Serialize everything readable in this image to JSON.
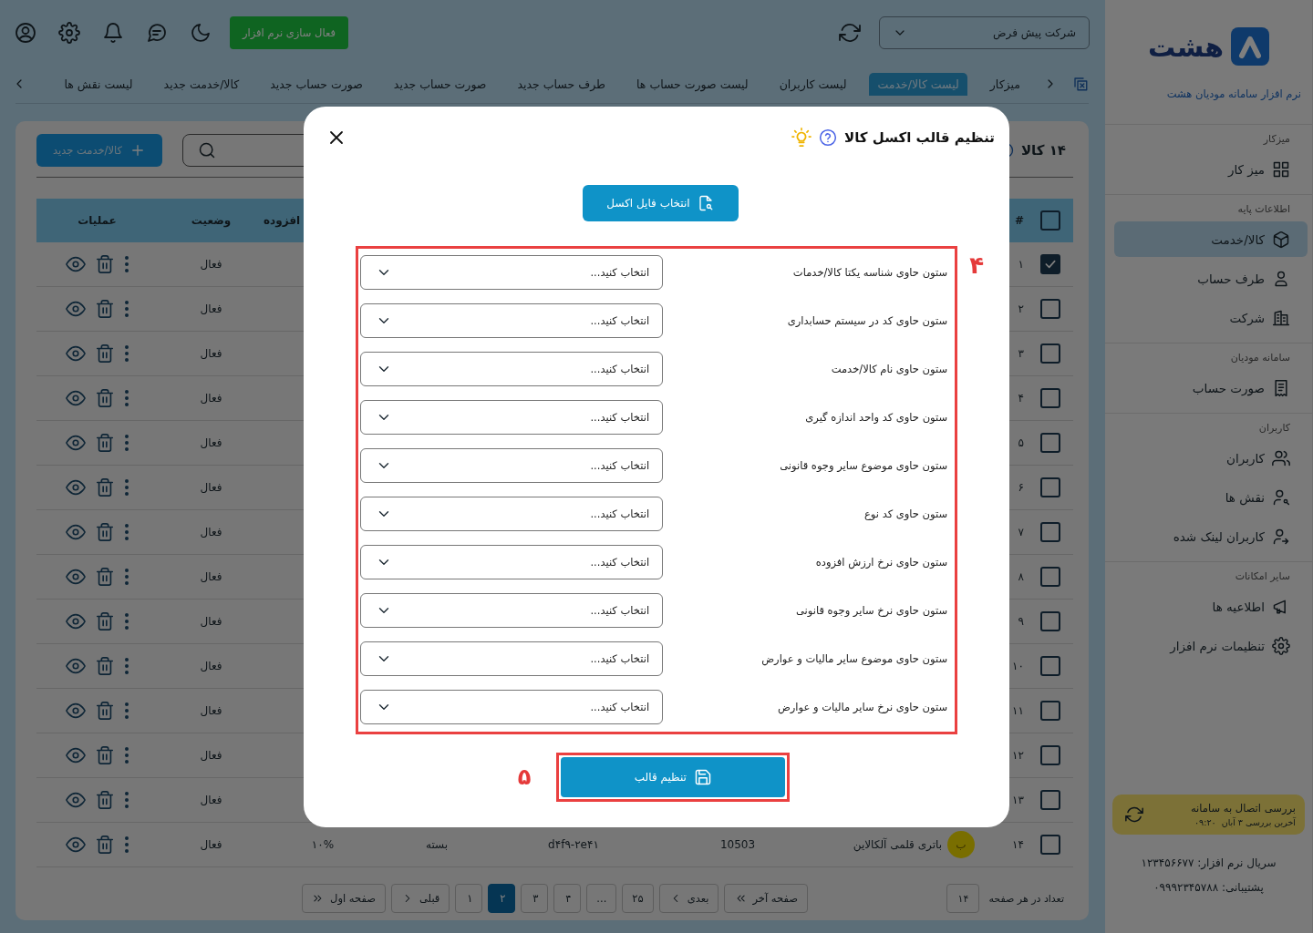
{
  "header": {
    "company_select": {
      "value": "شرکت پیش فرض"
    },
    "activate_button": "فعال سازی نرم افزار"
  },
  "tabs": [
    {
      "label": "میزکار",
      "selected": false
    },
    {
      "label": "لیست کالا/خدمت",
      "selected": true
    },
    {
      "label": "لیست کاربران",
      "selected": false
    },
    {
      "label": "لیست صورت حساب ها",
      "selected": false
    },
    {
      "label": "طرف حساب جدید",
      "selected": false
    },
    {
      "label": "صورت حساب جدید",
      "selected": false
    },
    {
      "label": "صورت حساب جدید",
      "selected": false
    },
    {
      "label": "کالا/خدمت جدید",
      "selected": false
    },
    {
      "label": "لیست نقش ها",
      "selected": false
    }
  ],
  "sidebar": {
    "logo": "هشت",
    "subtitle": "نرم افزار سامانه مودیان هشت",
    "sections": [
      {
        "title": "میزکار",
        "items": [
          {
            "label": "میز کار",
            "kind": "grid",
            "selected": false
          }
        ]
      },
      {
        "title": "اطلاعات پایه",
        "items": [
          {
            "label": "کالا/خدمت",
            "kind": "box",
            "selected": true
          },
          {
            "label": "طرف حساب",
            "kind": "person",
            "selected": false
          },
          {
            "label": "شرکت",
            "kind": "building",
            "selected": false
          }
        ]
      },
      {
        "title": "سامانه مودیان",
        "items": [
          {
            "label": "صورت حساب",
            "kind": "receipt",
            "selected": false
          }
        ]
      },
      {
        "title": "کاربران",
        "items": [
          {
            "label": "کاربران",
            "kind": "users",
            "selected": false
          },
          {
            "label": "نقش ها",
            "kind": "role",
            "selected": false
          },
          {
            "label": "کاربران لینک شده",
            "kind": "link",
            "selected": false
          }
        ]
      },
      {
        "title": "سایر امکانات",
        "items": [
          {
            "label": "اطلاعیه ها",
            "kind": "megaphone",
            "selected": false
          },
          {
            "label": "تنظیمات نرم افزار",
            "kind": "gear",
            "selected": false
          }
        ]
      }
    ],
    "status": {
      "title": "بررسی اتصال به سامانه",
      "last_check_label": "آخرین بررسی",
      "last_check": "۳ آبان  ۰۹:۲۰"
    },
    "serial": "سریال نرم افزار: ۱۲۳۴۵۶۶۷۷",
    "support": "پشتیبانی: ۰۹۹۹۲۳۴۵۷۸۸"
  },
  "list": {
    "title": "۱۴ کالا",
    "new_button": "کالا/خدمت جدید",
    "all_checked": false,
    "columns": {
      "number": "#",
      "tax": "افزوده",
      "status": "وضعیت",
      "actions": "عملیات"
    },
    "rows": [
      {
        "number": "۱",
        "checked": true,
        "status": "فعال"
      },
      {
        "number": "۲",
        "checked": false,
        "status": "فعال"
      },
      {
        "number": "۳",
        "checked": false,
        "status": "فعال"
      },
      {
        "number": "۴",
        "checked": false,
        "status": "فعال"
      },
      {
        "number": "۵",
        "checked": false,
        "status": "فعال"
      },
      {
        "number": "۶",
        "checked": false,
        "status": "فعال"
      },
      {
        "number": "۷",
        "checked": false,
        "status": "فعال"
      },
      {
        "number": "۸",
        "checked": false,
        "status": "فعال"
      },
      {
        "number": "۹",
        "checked": false,
        "status": "فعال"
      },
      {
        "number": "۱۰",
        "checked": false,
        "status": "فعال"
      },
      {
        "number": "۱۱",
        "checked": false,
        "status": "فعال"
      },
      {
        "number": "۱۲",
        "checked": false,
        "status": "فعال"
      },
      {
        "number": "۱۳",
        "checked": false,
        "status": "فعال"
      },
      {
        "number": "۱۴",
        "checked": false,
        "avatar": "ب",
        "name": "باتری قلمی آلکالاین",
        "code": "10503",
        "serial": "d۴f۹-۲e۴۱",
        "unit": "بسته",
        "tax": "۱۰%",
        "status": "فعال"
      }
    ],
    "pagination": {
      "page_size_label": "تعداد در هر صفحه",
      "page_size": "۱۴",
      "buttons": [
        {
          "label": "صفحه آخر",
          "kind": "last",
          "selected": false
        },
        {
          "label": "بعدی",
          "kind": "next",
          "selected": false
        },
        {
          "label": "۲۵",
          "kind": "page",
          "selected": false
        },
        {
          "label": "...",
          "kind": "gap",
          "selected": false
        },
        {
          "label": "۴",
          "kind": "page",
          "selected": false
        },
        {
          "label": "۳",
          "kind": "page",
          "selected": false
        },
        {
          "label": "۲",
          "kind": "page",
          "selected": true
        },
        {
          "label": "۱",
          "kind": "page",
          "selected": false
        },
        {
          "label": "قبلی",
          "kind": "prev",
          "selected": false
        },
        {
          "label": "صفحه اول",
          "kind": "first",
          "selected": false
        }
      ]
    }
  },
  "modal": {
    "title": "تنظیم قالب اکسل کالا",
    "file_button": "انتخاب فایل اکسل",
    "mapping_step": "۴",
    "fields": [
      {
        "label": "ستون حاوی شناسه یکتا کالا/خدمات",
        "placeholder": "انتخاب کنید..."
      },
      {
        "label": "ستون حاوی کد در سیستم حسابداری",
        "placeholder": "انتخاب کنید..."
      },
      {
        "label": "ستون حاوی نام کالا/خدمت",
        "placeholder": "انتخاب کنید..."
      },
      {
        "label": "ستون حاوی کد واحد اندازه گیری",
        "placeholder": "انتخاب کنید..."
      },
      {
        "label": "ستون حاوی موضوع سایر وجوه قانونی",
        "placeholder": "انتخاب کنید..."
      },
      {
        "label": "ستون حاوی کد نوع",
        "placeholder": "انتخاب کنید..."
      },
      {
        "label": "ستون حاوی نرخ ارزش افزوده",
        "placeholder": "انتخاب کنید..."
      },
      {
        "label": "ستون حاوی نرخ سایر وجوه قانونی",
        "placeholder": "انتخاب کنید..."
      },
      {
        "label": "ستون حاوی موضوع سایر مالیات و عوارض",
        "placeholder": "انتخاب کنید..."
      },
      {
        "label": "ستون حاوی نرخ سایر مالیات و عوارض",
        "placeholder": "انتخاب کنید..."
      }
    ],
    "save_button": "تنظیم قالب",
    "save_step": "۵"
  }
}
